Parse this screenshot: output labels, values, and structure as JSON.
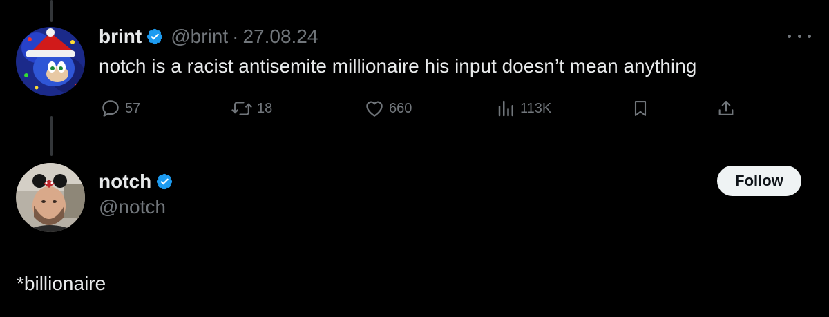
{
  "parent_tweet": {
    "display_name": "brint",
    "handle": "@brint",
    "separator": "·",
    "timestamp": "27.08.24",
    "text": "notch is a racist antisemite millionaire his input doesn’t mean anything",
    "avatar_icon": "sonic-christmas-avatar",
    "actions": {
      "reply_count": "57",
      "retweet_count": "18",
      "like_count": "660",
      "views_count": "113K"
    }
  },
  "reply_tweet": {
    "display_name": "notch",
    "handle": "@notch",
    "follow_label": "Follow",
    "text": "*billionaire",
    "avatar_icon": "bearded-man-avatar"
  },
  "colors": {
    "background": "#000000",
    "text": "#e7e9ea",
    "muted": "#71767b",
    "verified_blue": "#1d9bf0",
    "follow_bg": "#eff3f4"
  }
}
